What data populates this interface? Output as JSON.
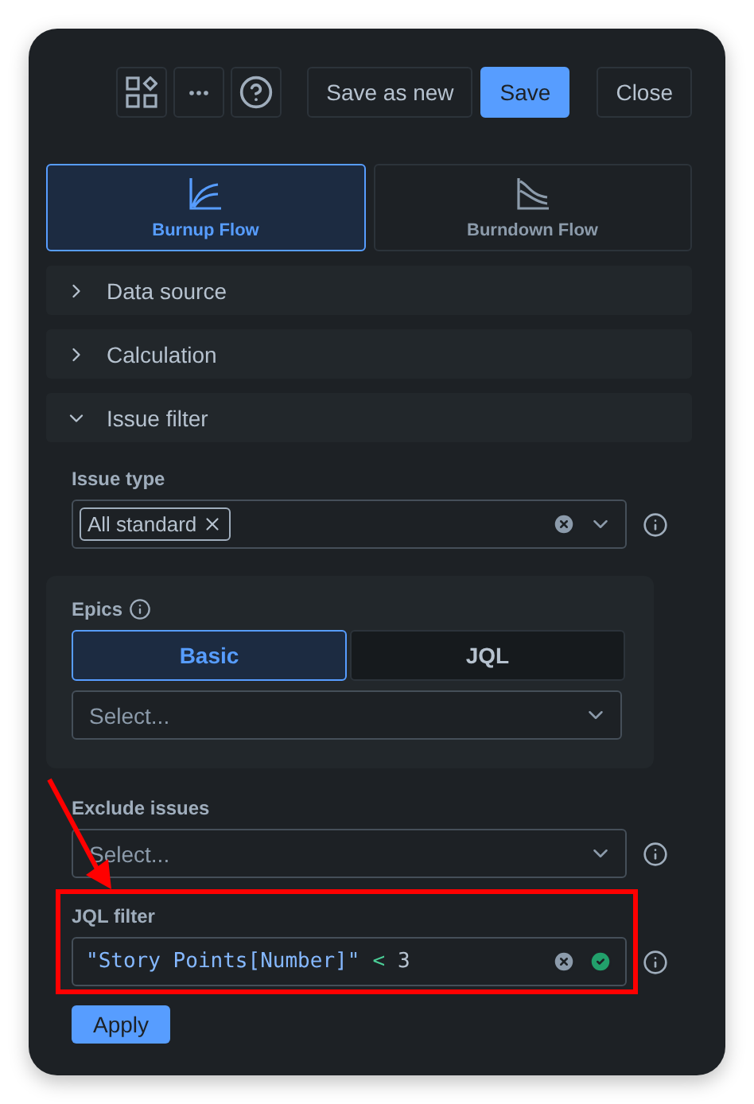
{
  "toolbar": {
    "icon_buttons": [
      {
        "kind": "shapes"
      },
      {
        "kind": "more"
      },
      {
        "kind": "help"
      }
    ],
    "buttons": [
      {
        "label": "Save as new",
        "kind": "secondary"
      },
      {
        "label": "Save",
        "kind": "primary"
      },
      {
        "label": "Close",
        "kind": "secondary"
      }
    ]
  },
  "chart_types": [
    {
      "label": "Burnup Flow",
      "kind": "burnup",
      "selected": true
    },
    {
      "label": "Burndown Flow",
      "kind": "burndown",
      "selected": false
    }
  ],
  "sections": [
    {
      "label": "Data source",
      "expanded": false
    },
    {
      "label": "Calculation",
      "expanded": false
    },
    {
      "label": "Issue filter",
      "expanded": true
    }
  ],
  "issue_type": {
    "label": "Issue type",
    "tags": [
      "All standard"
    ]
  },
  "epics": {
    "label": "Epics",
    "modes": [
      {
        "label": "Basic",
        "selected": true
      },
      {
        "label": "JQL",
        "selected": false
      }
    ],
    "placeholder": "Select..."
  },
  "exclude_issues": {
    "label": "Exclude issues",
    "placeholder": "Select..."
  },
  "jql_filter": {
    "label": "JQL filter",
    "highlighted": true,
    "valid": true,
    "parts": [
      {
        "text": "\"Story Points[Number]\"",
        "kind": "string"
      },
      {
        "text": "<",
        "kind": "operator"
      },
      {
        "text": "3",
        "kind": "number"
      }
    ]
  },
  "apply_button": "Apply"
}
